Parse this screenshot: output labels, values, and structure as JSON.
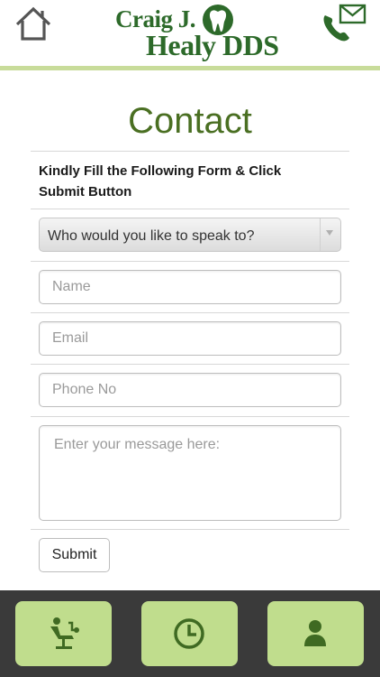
{
  "header": {
    "logo_line1": "Craig J.",
    "logo_line2": "Healy DDS",
    "home_icon": "home-icon",
    "phone_icon": "phone-mail-icon"
  },
  "page": {
    "title": "Contact",
    "instructions": "Kindly Fill the Following Form & Click Submit Button"
  },
  "form": {
    "recipient_select": "Who would you like to speak to?",
    "name_placeholder": "Name",
    "email_placeholder": "Email",
    "phone_placeholder": "Phone No",
    "message_placeholder": "Enter your message here:",
    "submit_label": "Submit"
  },
  "footer": {
    "buttons": [
      {
        "icon": "dental-chair-icon"
      },
      {
        "icon": "clock-icon"
      },
      {
        "icon": "user-icon"
      }
    ]
  },
  "colors": {
    "brand_green": "#2d6a2a",
    "title_green": "#4a6f22",
    "accent_light_green": "#c0dd8d",
    "footer_bg": "#3a3a3a"
  }
}
